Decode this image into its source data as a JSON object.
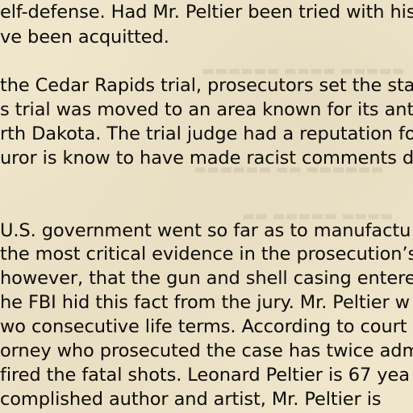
{
  "document": {
    "lines": [
      "elf-defense.  Had Mr. Peltier been tried with his",
      "ve been acquitted.",
      " the Cedar Rapids trial, prosecutors set the stag",
      "s trial was moved to an area known for its antie",
      "rth Dakota.  The trial judge had a reputation fo",
      "uror is know to have made racist comments du",
      " U.S. government went so far as to manufactu",
      " the most critical evidence in the prosecution’s",
      " however, that the gun and shell casing entere",
      "he FBI hid this fact from the jury.  Mr. Peltier w",
      "wo consecutive life terms.  According to court",
      "orney who prosecuted the case has twice admi",
      "fired the fatal shots.   Leonard Peltier is 67 yea",
      "complished author and artist, Mr. Peltier is"
    ]
  }
}
